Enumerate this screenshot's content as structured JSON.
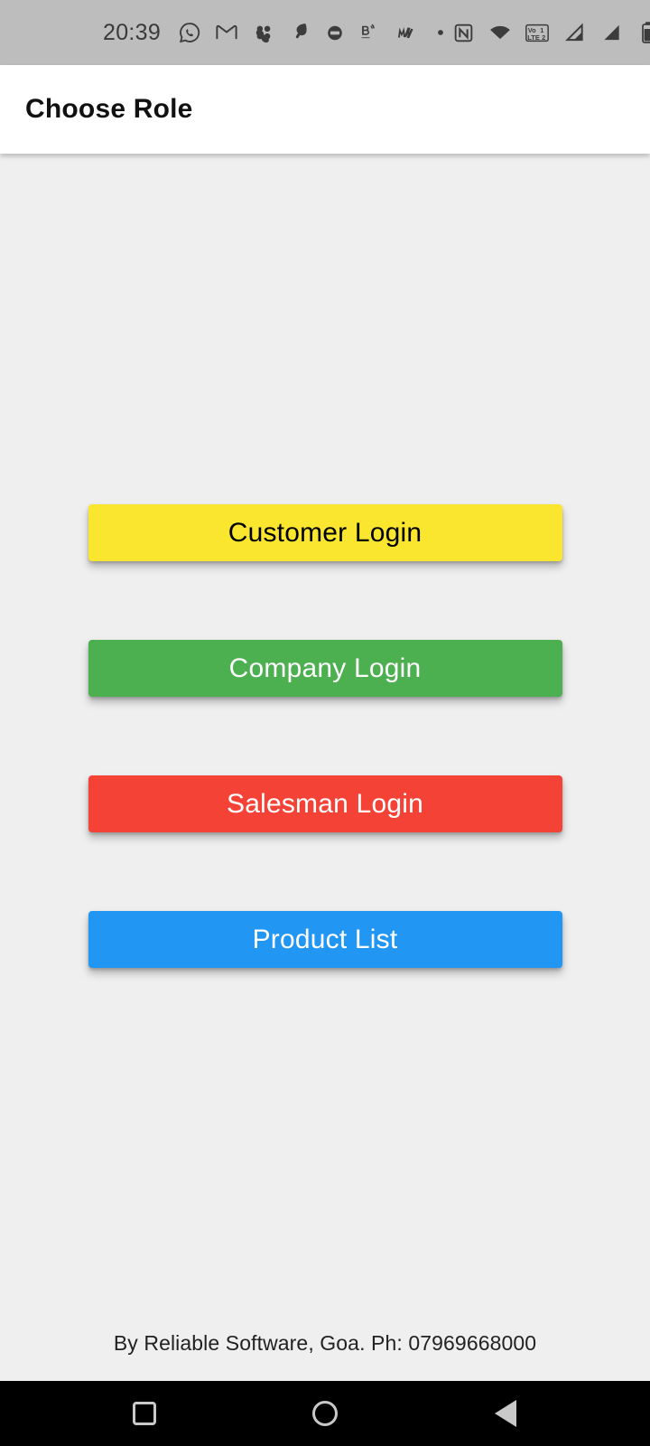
{
  "status_bar": {
    "time": "20:39",
    "left_icons": [
      "whatsapp-icon",
      "gmail-icon",
      "flipkart-icon",
      "lightning-app-icon",
      "messaging-app-icon",
      "bluetooth-share-icon",
      "myjio-icon",
      "dot-icon"
    ],
    "right_icons": [
      "nfc-icon",
      "wifi-icon",
      "volte-icon",
      "signal-sim1-icon",
      "signal-sim2-icon",
      "battery-icon"
    ],
    "volte_label_top": "Vo 1",
    "volte_label_bottom": "LTE 2"
  },
  "app_bar": {
    "title": "Choose Role"
  },
  "main": {
    "buttons": [
      {
        "label": "Customer Login",
        "bg": "#FAE62E",
        "fg": "#000000",
        "name": "customer-login-button"
      },
      {
        "label": "Company Login",
        "bg": "#4CAF50",
        "fg": "#FFFFFF",
        "name": "company-login-button"
      },
      {
        "label": "Salesman Login",
        "bg": "#F44336",
        "fg": "#FFFFFF",
        "name": "salesman-login-button"
      },
      {
        "label": "Product List",
        "bg": "#2196F3",
        "fg": "#FFFFFF",
        "name": "product-list-button"
      }
    ]
  },
  "footer": {
    "text": "By Reliable Software, Goa. Ph: 07969668000"
  },
  "nav_bar": {
    "recents_label": "Recents",
    "home_label": "Home",
    "back_label": "Back"
  },
  "colors": {
    "status_bar_bg": "#BDBDBD",
    "app_bar_bg": "#FFFFFF",
    "content_bg": "#EFEFEF",
    "nav_bar_bg": "#000000",
    "yellow": "#FAE62E",
    "green": "#4CAF50",
    "red": "#F44336",
    "blue": "#2196F3"
  }
}
